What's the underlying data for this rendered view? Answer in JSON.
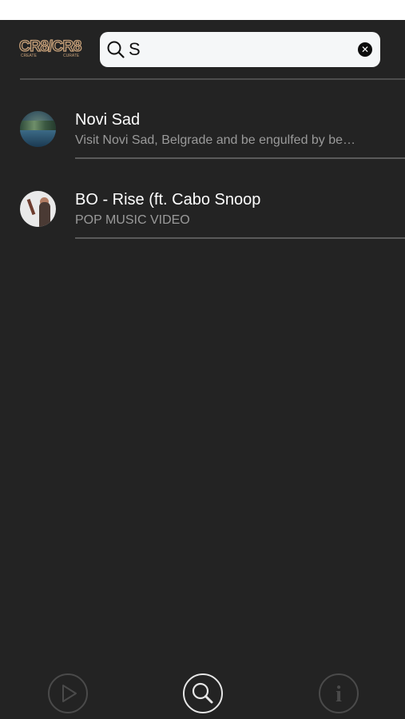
{
  "header": {
    "logo_text": "CR8/CR8",
    "logo_sub_left": "CREATE",
    "logo_sub_right": "CURATE"
  },
  "search": {
    "value": "S",
    "placeholder": "",
    "icon": "search-icon",
    "clear_icon": "clear-icon"
  },
  "results": [
    {
      "title": "Novi Sad",
      "subtitle": "Visit Novi Sad, Belgrade and be engulfed by be…",
      "thumbnail": "river-landscape-thumbnail"
    },
    {
      "title": "BO - Rise (ft. Cabo Snoop",
      "subtitle": "POP MUSIC VIDEO",
      "thumbnail": "artist-thumbnail"
    }
  ],
  "tabs": [
    {
      "name": "play",
      "icon": "play-icon",
      "active": false
    },
    {
      "name": "search",
      "icon": "search-icon",
      "active": true
    },
    {
      "name": "info",
      "icon": "info-icon",
      "active": false
    }
  ],
  "colors": {
    "background": "#232323",
    "status_bar": "#ffffff",
    "search_field": "#f5f7f8",
    "title_text": "#ffffff",
    "subtitle_text": "#9a9a9a",
    "logo_accent": "#c9a27a",
    "tab_active": "#e6e6e6",
    "tab_inactive": "#4a4a4a",
    "caret": "#2f6bff"
  }
}
